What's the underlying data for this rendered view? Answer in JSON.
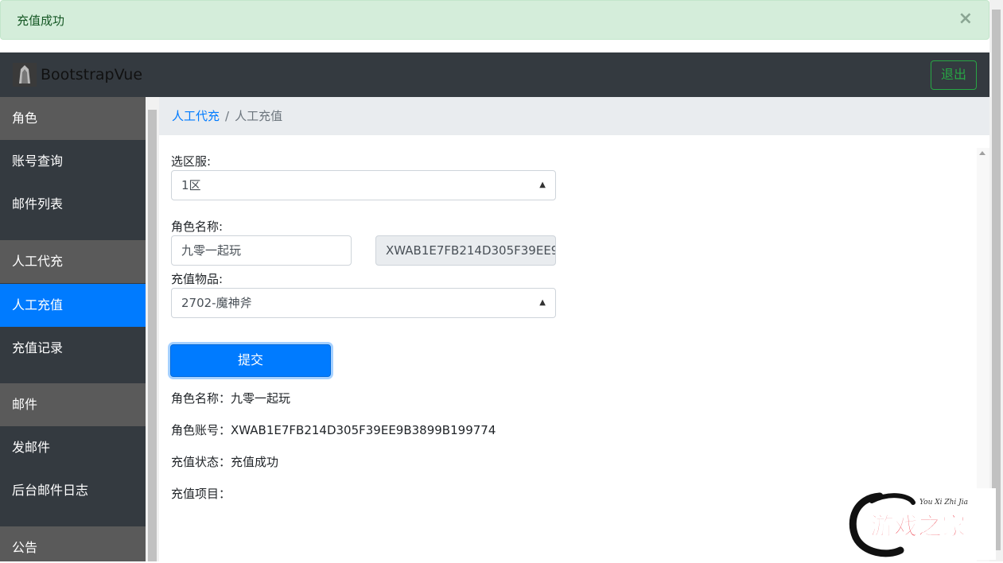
{
  "alert": {
    "message": "充值成功",
    "close": "×"
  },
  "navbar": {
    "brand": "BootstrapVue",
    "logout": "退出"
  },
  "sidebar": {
    "items": [
      {
        "label": "角色",
        "type": "header"
      },
      {
        "label": "账号查询",
        "type": "item"
      },
      {
        "label": "邮件列表",
        "type": "item"
      },
      {
        "label": "人工代充",
        "type": "header"
      },
      {
        "label": "人工充值",
        "type": "active"
      },
      {
        "label": "充值记录",
        "type": "item"
      },
      {
        "label": "邮件",
        "type": "header"
      },
      {
        "label": "发邮件",
        "type": "item"
      },
      {
        "label": "后台邮件日志",
        "type": "item"
      },
      {
        "label": "公告",
        "type": "header"
      }
    ]
  },
  "breadcrumb": {
    "parent": "人工代充",
    "separator": "/",
    "current": "人工充值"
  },
  "form": {
    "server_label": "选区服:",
    "server_value": "1区",
    "role_label": "角色名称:",
    "role_name": "九零一起玩",
    "role_account": "XWAB1E7FB214D305F39EE9B3899B199774",
    "item_label": "充值物品:",
    "item_value": "2702-魔神斧",
    "submit": "提交"
  },
  "result": {
    "name_line": "角色名称：九零一起玩",
    "account_line": "角色账号：XWAB1E7FB214D305F39EE9B3899B199774",
    "status_line": "充值状态：充值成功",
    "items_line": "充值项目："
  },
  "watermark": {
    "title": "游戏之家",
    "subtitle": "You Xi Zhi Jia"
  },
  "colors": {
    "primary": "#007bff",
    "success_bg": "#d4edda",
    "navbar": "#343a40",
    "logout": "#28a745"
  }
}
